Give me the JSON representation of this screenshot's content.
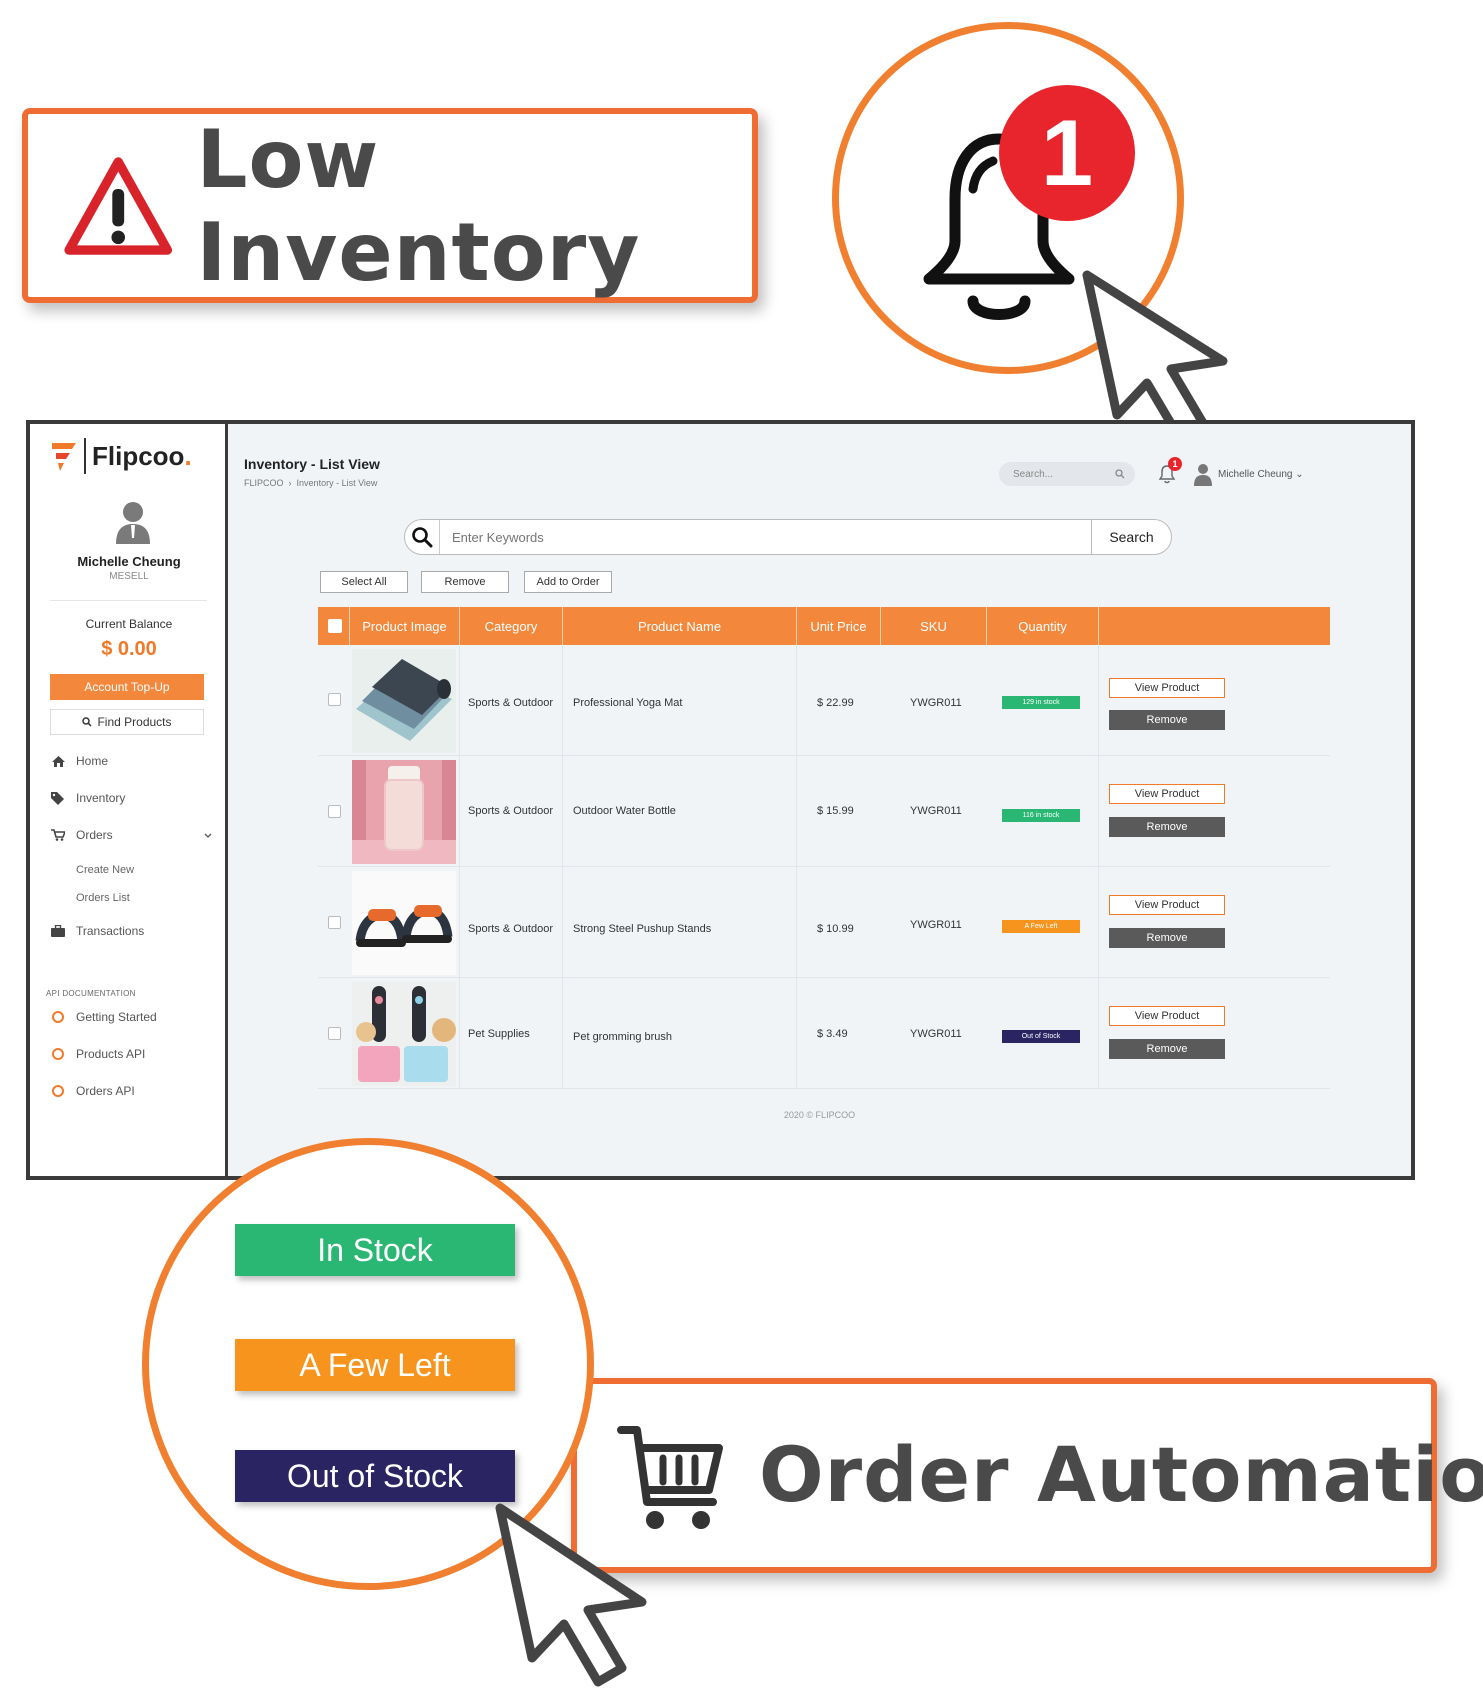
{
  "callouts": {
    "low_inventory": "Low Inventory",
    "notification_count": "1",
    "order_automation": "Order Automation"
  },
  "status_pills": {
    "in_stock": "In Stock",
    "a_few_left": "A Few Left",
    "out_of_stock": "Out of Stock"
  },
  "colors": {
    "accent": "#f3883c",
    "in_stock": "#2ab673",
    "a_few_left": "#f7941d",
    "out_of_stock": "#2b2462",
    "badge_red": "#e8252d",
    "remove_btn": "#5a5a5a"
  },
  "sidebar": {
    "brand": "Flipcoo",
    "brand_dot": ".",
    "user_name": "Michelle Cheung",
    "user_sub": "MESELL",
    "balance_label": "Current Balance",
    "balance": "$ 0.00",
    "topup_label": "Account Top-Up",
    "find_label": "Find Products",
    "nav": {
      "home": "Home",
      "inventory": "Inventory",
      "orders": "Orders",
      "create_new": "Create New",
      "orders_list": "Orders List",
      "transactions": "Transactions"
    },
    "api_heading": "API DOCUMENTATION",
    "api": {
      "getting_started": "Getting Started",
      "products_api": "Products API",
      "orders_api": "Orders API"
    }
  },
  "header": {
    "title": "Inventory - List View",
    "breadcrumb": [
      "FLIPCOO",
      "›",
      "Inventory - List View"
    ],
    "search_placeholder": "Search...",
    "notification_count": "1",
    "user_name": "Michelle Cheung"
  },
  "search_bar": {
    "placeholder": "Enter Keywords",
    "button": "Search"
  },
  "actions": {
    "select_all": "Select All",
    "remove": "Remove",
    "add_to_order": "Add to Order"
  },
  "table": {
    "columns": [
      "Product Image",
      "Category",
      "Product Name",
      "Unit Price",
      "SKU",
      "Quantity"
    ],
    "rows": [
      {
        "category": "Sports & Outdoor",
        "name": "Professional Yoga Mat",
        "price": "$ 22.99",
        "sku": "YWGR011",
        "quantity": "129 in stock",
        "status": "in_stock",
        "image": "yoga-mat"
      },
      {
        "category": "Sports & Outdoor",
        "name": "Outdoor Water Bottle",
        "price": "$ 15.99",
        "sku": "YWGR011",
        "quantity": "116 in stock",
        "status": "in_stock",
        "image": "water-bottle"
      },
      {
        "category": "Sports & Outdoor",
        "name": "Strong Steel Pushup Stands",
        "price": "$ 10.99",
        "sku": "YWGR011",
        "quantity": "A Few Left",
        "status": "a_few_left",
        "image": "pushup-stands"
      },
      {
        "category": "Pet Supplies",
        "name": "Pet gromming brush",
        "price": "$ 3.49",
        "sku": "YWGR011",
        "quantity": "Out of Stock",
        "status": "out_of_stock",
        "image": "pet-brush"
      }
    ],
    "view_label": "View Product",
    "remove_label": "Remove"
  },
  "footer": "2020 © FLIPCOO"
}
